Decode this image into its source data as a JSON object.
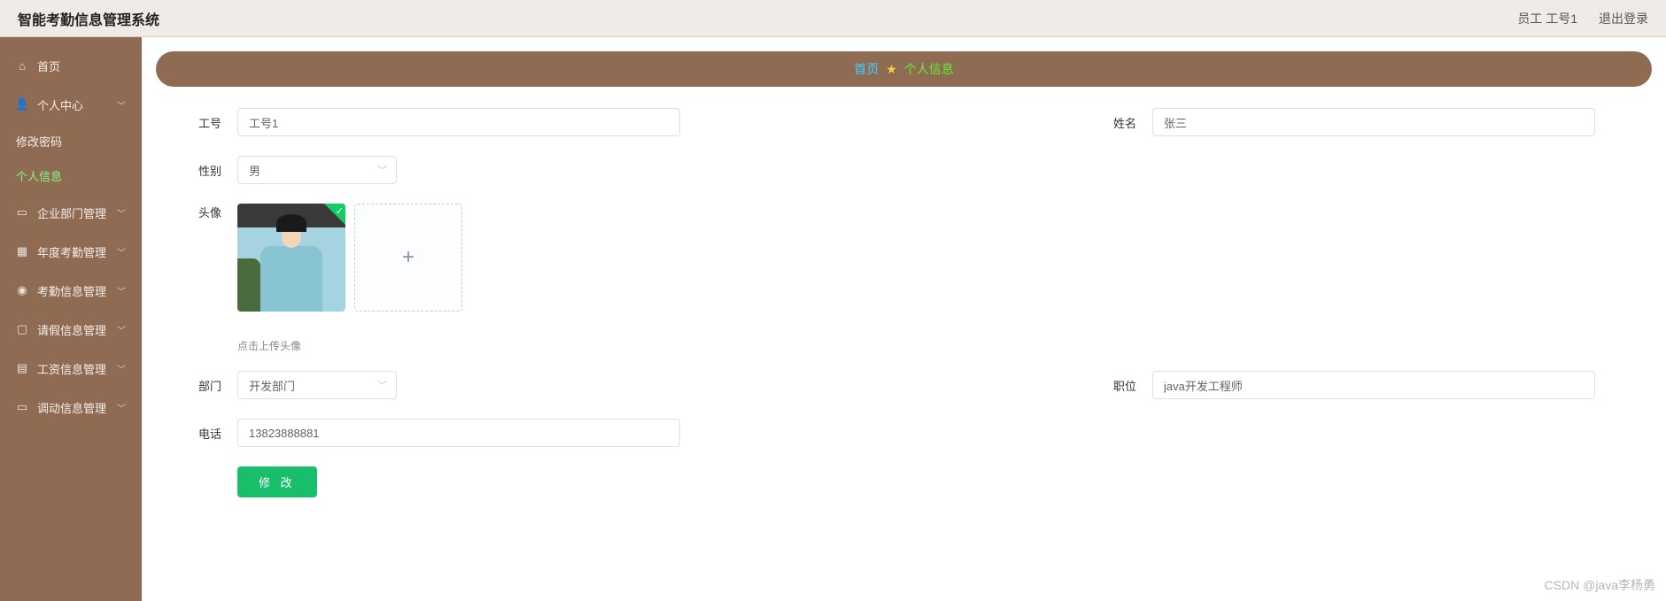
{
  "topbar": {
    "title": "智能考勤信息管理系统",
    "user_label": "员工 工号1",
    "logout_label": "退出登录"
  },
  "sidebar": {
    "home": "首页",
    "personal_center": "个人中心",
    "change_password": "修改密码",
    "personal_info": "个人信息",
    "enterprise_dept": "企业部门管理",
    "annual_attendance": "年度考勤管理",
    "attendance_info": "考勤信息管理",
    "leave_info": "请假信息管理",
    "salary_info": "工资信息管理",
    "transfer_info": "调动信息管理"
  },
  "breadcrumb": {
    "home": "首页",
    "star": "★",
    "current": "个人信息"
  },
  "form": {
    "emp_id_label": "工号",
    "emp_id_value": "工号1",
    "name_label": "姓名",
    "name_value": "张三",
    "gender_label": "性别",
    "gender_value": "男",
    "avatar_label": "头像",
    "upload_hint": "点击上传头像",
    "dept_label": "部门",
    "dept_value": "开发部门",
    "position_label": "职位",
    "position_value": "java开发工程师",
    "phone_label": "电话",
    "phone_value": "13823888881",
    "submit_label": "修 改"
  },
  "watermark": "CSDN @java李杨勇"
}
